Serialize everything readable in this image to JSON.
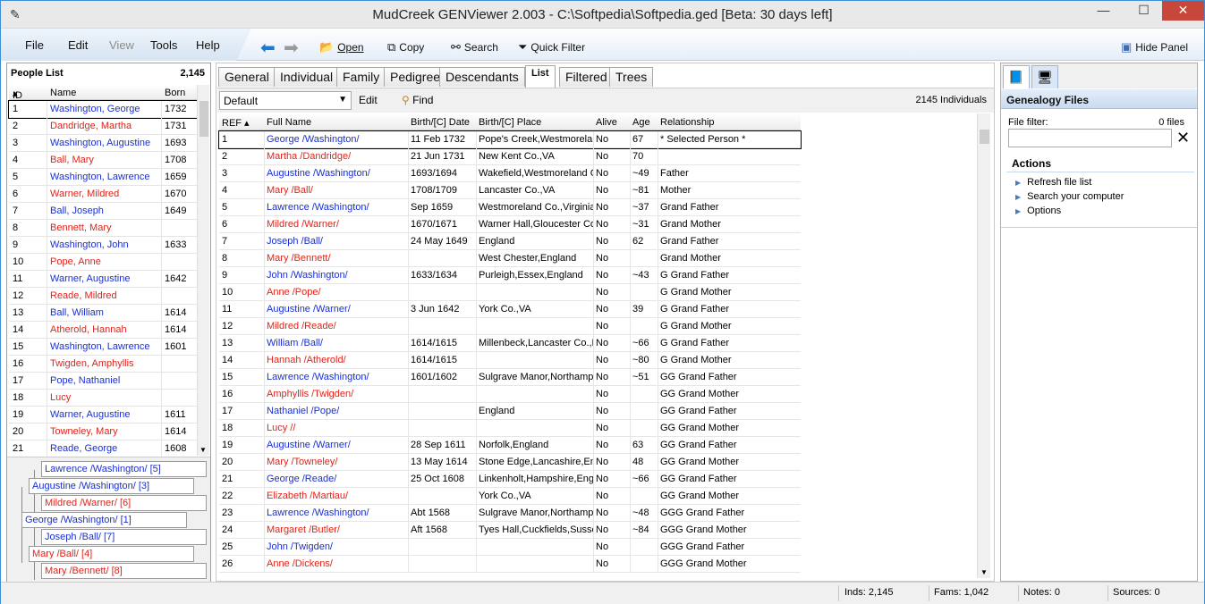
{
  "window": {
    "title": "MudCreek GENViewer 2.003 - C:\\Softpedia\\Softpedia.ged [Beta: 30 days left]",
    "app_icon": "pencil-icon",
    "minimize": "—",
    "maximize": "☐",
    "close": "✕"
  },
  "menu": {
    "file": "File",
    "edit": "Edit",
    "view": "View",
    "tools": "Tools",
    "help": "Help"
  },
  "toolbar": {
    "open": "Open",
    "copy": "Copy",
    "search": "Search",
    "quick_filter": "Quick Filter",
    "hide_panel": "Hide Panel"
  },
  "people_list": {
    "title": "People List",
    "count": "2,145",
    "col_id": "ID",
    "col_name": "Name",
    "col_born": "Born",
    "rows": [
      {
        "id": "1",
        "name": "Washington, George",
        "born": "1732",
        "sex": "m"
      },
      {
        "id": "2",
        "name": "Dandridge, Martha",
        "born": "1731",
        "sex": "f"
      },
      {
        "id": "3",
        "name": "Washington, Augustine",
        "born": "1693",
        "sex": "m"
      },
      {
        "id": "4",
        "name": "Ball, Mary",
        "born": "1708",
        "sex": "f"
      },
      {
        "id": "5",
        "name": "Washington, Lawrence",
        "born": "1659",
        "sex": "m"
      },
      {
        "id": "6",
        "name": "Warner, Mildred",
        "born": "1670",
        "sex": "f"
      },
      {
        "id": "7",
        "name": "Ball, Joseph",
        "born": "1649",
        "sex": "m"
      },
      {
        "id": "8",
        "name": "Bennett, Mary",
        "born": "",
        "sex": "f"
      },
      {
        "id": "9",
        "name": "Washington, John",
        "born": "1633",
        "sex": "m"
      },
      {
        "id": "10",
        "name": "Pope, Anne",
        "born": "",
        "sex": "f"
      },
      {
        "id": "11",
        "name": "Warner, Augustine",
        "born": "1642",
        "sex": "m"
      },
      {
        "id": "12",
        "name": "Reade, Mildred",
        "born": "",
        "sex": "f"
      },
      {
        "id": "13",
        "name": "Ball, William",
        "born": "1614",
        "sex": "m"
      },
      {
        "id": "14",
        "name": "Atherold, Hannah",
        "born": "1614",
        "sex": "f"
      },
      {
        "id": "15",
        "name": "Washington, Lawrence",
        "born": "1601",
        "sex": "m"
      },
      {
        "id": "16",
        "name": "Twigden, Amphyllis",
        "born": "",
        "sex": "f"
      },
      {
        "id": "17",
        "name": "Pope, Nathaniel",
        "born": "",
        "sex": "m"
      },
      {
        "id": "18",
        "name": "Lucy",
        "born": "",
        "sex": "f"
      },
      {
        "id": "19",
        "name": "Warner, Augustine",
        "born": "1611",
        "sex": "m"
      },
      {
        "id": "20",
        "name": "Towneley, Mary",
        "born": "1614",
        "sex": "f"
      },
      {
        "id": "21",
        "name": "Reade, George",
        "born": "1608",
        "sex": "m"
      }
    ]
  },
  "tree": [
    {
      "label": "Lawrence /Washington/ [5]",
      "sex": "m"
    },
    {
      "label": "Augustine /Washington/ [3]",
      "sex": "m"
    },
    {
      "label": "Mildred /Warner/ [6]",
      "sex": "f"
    },
    {
      "label": "George /Washington/ [1]",
      "sex": "m"
    },
    {
      "label": "Joseph /Ball/ [7]",
      "sex": "m"
    },
    {
      "label": "Mary /Ball/ [4]",
      "sex": "f"
    },
    {
      "label": "Mary /Bennett/ [8]",
      "sex": "f"
    }
  ],
  "tabs": [
    "General",
    "Individual",
    "Family",
    "Pedigree",
    "Descendants",
    "List",
    "Filtered",
    "Trees"
  ],
  "active_tab": "List",
  "list_view": {
    "combo_value": "Default",
    "edit": "Edit",
    "find": "Find",
    "count": "2145 Individuals",
    "cols": [
      "REF",
      "Full Name",
      "Birth/[C] Date",
      "Birth/[C] Place",
      "Alive",
      "Age",
      "Relationship"
    ],
    "rows": [
      {
        "ref": "1",
        "name": "George /Washington/",
        "date": "11 Feb 1732",
        "place": "Pope's Creek,Westmoreland",
        "alive": "No",
        "age": "67",
        "rel": "* Selected Person *",
        "sex": "m"
      },
      {
        "ref": "2",
        "name": "Martha /Dandridge/",
        "date": "21 Jun 1731",
        "place": "New Kent Co.,VA",
        "alive": "No",
        "age": "70",
        "rel": "",
        "sex": "f"
      },
      {
        "ref": "3",
        "name": "Augustine /Washington/",
        "date": "1693/1694",
        "place": "Wakefield,Westmoreland C",
        "alive": "No",
        "age": "~49",
        "rel": "Father",
        "sex": "m"
      },
      {
        "ref": "4",
        "name": "Mary /Ball/",
        "date": "1708/1709",
        "place": "Lancaster Co.,VA",
        "alive": "No",
        "age": "~81",
        "rel": "Mother",
        "sex": "f"
      },
      {
        "ref": "5",
        "name": "Lawrence /Washington/",
        "date": "Sep 1659",
        "place": "Westmoreland Co.,Virginia",
        "alive": "No",
        "age": "~37",
        "rel": "Grand Father",
        "sex": "m"
      },
      {
        "ref": "6",
        "name": "Mildred /Warner/",
        "date": "1670/1671",
        "place": "Warner Hall,Gloucester Co",
        "alive": "No",
        "age": "~31",
        "rel": "Grand Mother",
        "sex": "f"
      },
      {
        "ref": "7",
        "name": "Joseph /Ball/",
        "date": "24 May 1649",
        "place": "England",
        "alive": "No",
        "age": "62",
        "rel": "Grand Father",
        "sex": "m"
      },
      {
        "ref": "8",
        "name": "Mary /Bennett/",
        "date": "",
        "place": "West Chester,England",
        "alive": "No",
        "age": "",
        "rel": "Grand Mother",
        "sex": "f"
      },
      {
        "ref": "9",
        "name": "John /Washington/",
        "date": "1633/1634",
        "place": "Purleigh,Essex,England",
        "alive": "No",
        "age": "~43",
        "rel": "G Grand Father",
        "sex": "m"
      },
      {
        "ref": "10",
        "name": "Anne /Pope/",
        "date": "",
        "place": "",
        "alive": "No",
        "age": "",
        "rel": "G Grand Mother",
        "sex": "f"
      },
      {
        "ref": "11",
        "name": "Augustine /Warner/",
        "date": "3 Jun 1642",
        "place": "York Co.,VA",
        "alive": "No",
        "age": "39",
        "rel": "G Grand Father",
        "sex": "m"
      },
      {
        "ref": "12",
        "name": "Mildred /Reade/",
        "date": "",
        "place": "",
        "alive": "No",
        "age": "",
        "rel": "G Grand Mother",
        "sex": "f"
      },
      {
        "ref": "13",
        "name": "William /Ball/",
        "date": "1614/1615",
        "place": "Millenbeck,Lancaster Co.,E",
        "alive": "No",
        "age": "~66",
        "rel": "G Grand Father",
        "sex": "m"
      },
      {
        "ref": "14",
        "name": "Hannah /Atherold/",
        "date": "1614/1615",
        "place": "",
        "alive": "No",
        "age": "~80",
        "rel": "G Grand Mother",
        "sex": "f"
      },
      {
        "ref": "15",
        "name": "Lawrence /Washington/",
        "date": "1601/1602",
        "place": "Sulgrave Manor,Northampt",
        "alive": "No",
        "age": "~51",
        "rel": "GG Grand Father",
        "sex": "m"
      },
      {
        "ref": "16",
        "name": "Amphyllis /Twigden/",
        "date": "",
        "place": "",
        "alive": "No",
        "age": "",
        "rel": "GG Grand Mother",
        "sex": "f"
      },
      {
        "ref": "17",
        "name": "Nathaniel /Pope/",
        "date": "",
        "place": "England",
        "alive": "No",
        "age": "",
        "rel": "GG Grand Father",
        "sex": "m"
      },
      {
        "ref": "18",
        "name": "Lucy //",
        "date": "",
        "place": "",
        "alive": "No",
        "age": "",
        "rel": "GG Grand Mother",
        "sex": "f"
      },
      {
        "ref": "19",
        "name": "Augustine /Warner/",
        "date": "28 Sep 1611",
        "place": "Norfolk,England",
        "alive": "No",
        "age": "63",
        "rel": "GG Grand Father",
        "sex": "m"
      },
      {
        "ref": "20",
        "name": "Mary /Towneley/",
        "date": "13 May 1614",
        "place": "Stone Edge,Lancashire,En",
        "alive": "No",
        "age": "48",
        "rel": "GG Grand Mother",
        "sex": "f"
      },
      {
        "ref": "21",
        "name": "George /Reade/",
        "date": "25 Oct 1608",
        "place": "Linkenholt,Hampshire,Engl",
        "alive": "No",
        "age": "~66",
        "rel": "GG Grand Father",
        "sex": "m"
      },
      {
        "ref": "22",
        "name": "Elizabeth /Martiau/",
        "date": "",
        "place": "York Co.,VA",
        "alive": "No",
        "age": "",
        "rel": "GG Grand Mother",
        "sex": "f"
      },
      {
        "ref": "23",
        "name": "Lawrence /Washington/",
        "date": "Abt 1568",
        "place": "Sulgrave Manor,Northampt",
        "alive": "No",
        "age": "~48",
        "rel": "GGG Grand Father",
        "sex": "m"
      },
      {
        "ref": "24",
        "name": "Margaret /Butler/",
        "date": "Aft 1568",
        "place": "Tyes Hall,Cuckfields,Susse",
        "alive": "No",
        "age": "~84",
        "rel": "GGG Grand Mother",
        "sex": "f"
      },
      {
        "ref": "25",
        "name": "John /Twigden/",
        "date": "",
        "place": "",
        "alive": "No",
        "age": "",
        "rel": "GGG Grand Father",
        "sex": "m"
      },
      {
        "ref": "26",
        "name": "Anne /Dickens/",
        "date": "",
        "place": "",
        "alive": "No",
        "age": "",
        "rel": "GGG Grand Mother",
        "sex": "f"
      }
    ]
  },
  "right_panel": {
    "title": "Genealogy Files",
    "file_filter_label": "File filter:",
    "file_count": "0 files",
    "actions_title": "Actions",
    "actions": [
      "Refresh file list",
      "Search your computer",
      "Options"
    ]
  },
  "status": {
    "inds": "Inds: 2,145",
    "fams": "Fams: 1,042",
    "notes": "Notes: 0",
    "sources": "Sources: 0"
  },
  "colors": {
    "male": "#1a2fd0",
    "female": "#e2231a",
    "accent": "#3f8fd2"
  }
}
